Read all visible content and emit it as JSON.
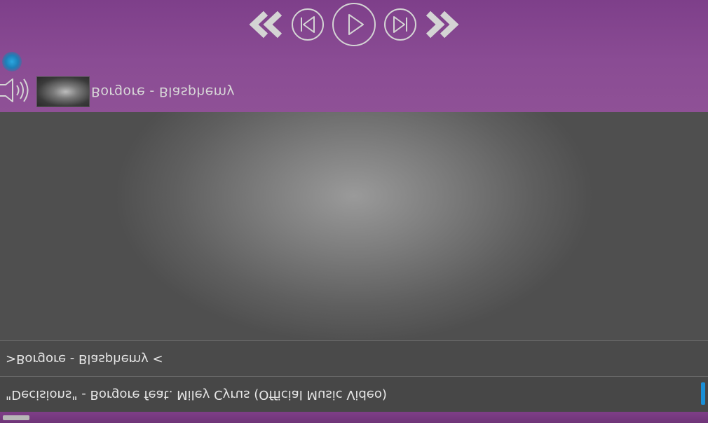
{
  "player": {
    "now_playing_title": "Borgore - Blasphemy",
    "controls": [
      {
        "name": "rewind-icon"
      },
      {
        "name": "previous-track-icon"
      },
      {
        "name": "play-icon"
      },
      {
        "name": "next-track-icon"
      },
      {
        "name": "fast-forward-icon"
      }
    ]
  },
  "playlist": {
    "items": [
      {
        "label": ">Borgore - Blasphemy <"
      },
      {
        "label": "\"Decisions\" - Borgore feat. Miley Cyrus (Official Music Video)"
      }
    ]
  },
  "colors": {
    "bar_purple": "#8a4c94",
    "accent_blue": "#1a8fd6",
    "icon_gray": "#d4d4d4"
  }
}
